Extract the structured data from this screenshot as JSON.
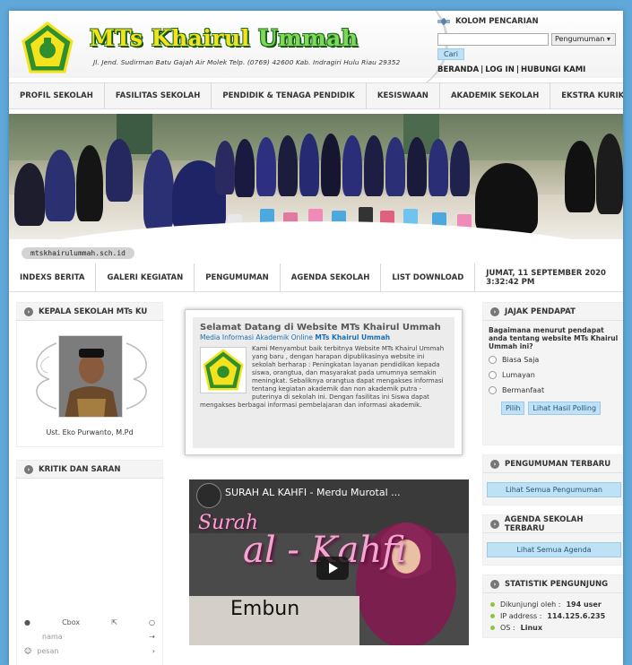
{
  "header": {
    "title_part1": "MTs Khairul",
    "title_part2": "Ummah",
    "address": "Jl. Jend. Sudirman Batu Gajah Air Molek Telp. (0769) 42600  Kab. Indragiri Hulu Riau 29352"
  },
  "search": {
    "heading": "KOLOM PENCARIAN",
    "input_value": "",
    "select_value": "Pengumuman ▾",
    "button": "Cari"
  },
  "top_links": [
    "BERANDA",
    "LOG IN",
    "HUBUNGI KAMI"
  ],
  "nav": [
    "PROFIL SEKOLAH",
    "FASILITAS SEKOLAH",
    "PENDIDIK & TENAGA PENDIDIK",
    "KESISWAAN",
    "AKADEMIK SEKOLAH",
    "EKSTRA KURIKULER"
  ],
  "banner_url": "mtskhairulummah.sch.id",
  "nav2": [
    "INDEXS BERITA",
    "GALERI KEGIATAN",
    "PENGUMUMAN",
    "AGENDA SEKOLAH",
    "LIST DOWNLOAD"
  ],
  "datetime": "JUMAT, 11 SEPTEMBER 2020 3:32:42 PM",
  "kepala": {
    "heading": "KEPALA SEKOLAH MTs KU",
    "name": "Ust. Eko Purwanto, M.Pd"
  },
  "kritik": {
    "heading": "KRITIK DAN SARAN",
    "cbox_label": "Cbox",
    "name_placeholder": "nama",
    "message_placeholder": "pesan"
  },
  "welcome": {
    "title": "Selamat Datang di Website MTs Khairul Ummah",
    "subtitle": "Media Informasi Akademik Online",
    "subtitle_bold": "MTs Khairul Ummah",
    "body": "Kami Menyambut baik terbitnya Website MTs Khairul Ummah yang baru , dengan harapan dipublikasinya website ini sekolah berharap : Peningkatan layanan pendidikan kepada siswa, orangtua, dan masyarakat pada umumnya semakin meningkat. Sebaliknya orangtua dapat mengakses informasi tentang kegiatan akademik dan non akademik putra - puterinya di sekolah ini. Dengan fasilitas ini Siswa dapat mengakses berbagai informasi pembelajaran dan informasi akademik."
  },
  "video": {
    "title": "SURAH AL KAHFI - Merdu Murotal ...",
    "overlay1": "Surah",
    "overlay2": "al - Kahfi",
    "overlay3": "Embun"
  },
  "jajak": {
    "heading": "JAJAK PENDAPAT",
    "question": "Bagaimana menurut pendapat anda tentang website MTs Khairul Ummah ini?",
    "options": [
      "Biasa Saja",
      "Lumayan",
      "Bermanfaat"
    ],
    "vote_button": "Pilih",
    "results_button": "Lihat Hasil Polling"
  },
  "pengumuman": {
    "heading": "PENGUMUMAN TERBARU",
    "button": "Lihat Semua Pengumuman"
  },
  "agenda": {
    "heading": "AGENDA SEKOLAH TERBARU",
    "button": "Lihat Semua Agenda"
  },
  "statistik": {
    "heading": "STATISTIK PENGUNJUNG",
    "rows": [
      {
        "label": "Dikunjungi oleh :",
        "value": "194 user"
      },
      {
        "label": "IP address :",
        "value": "114.125.6.235"
      },
      {
        "label": "OS :",
        "value": "Linux"
      }
    ]
  },
  "colors": {
    "page_bg": "#5fa8d9",
    "title_yellow": "#f4e21c",
    "title_green": "#7ed957",
    "button_blue": "#bfe1f5",
    "link_blue": "#1a6fb5"
  }
}
